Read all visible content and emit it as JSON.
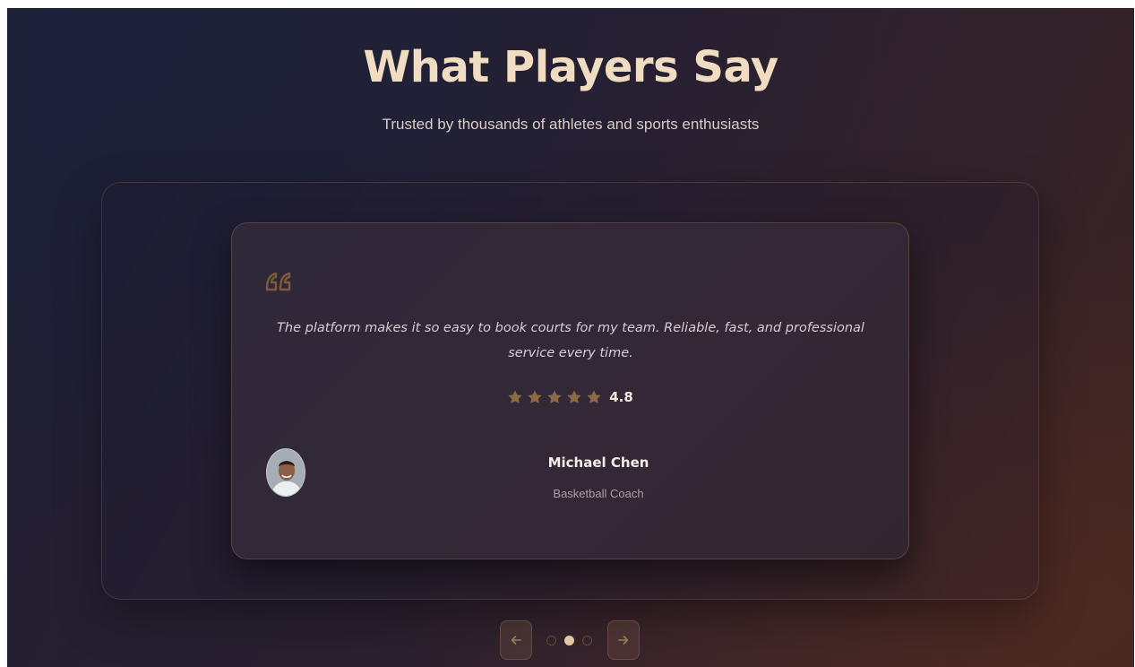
{
  "header": {
    "title": "What Players Say",
    "subtitle": "Trusted by thousands of athletes and sports enthusiasts"
  },
  "testimonial": {
    "quote": "The platform makes it so easy to book courts for my team. Reliable, fast, and professional service every time.",
    "rating": 4.8,
    "rating_label": "4.8",
    "stars": 5,
    "author": {
      "name": "Michael Chen",
      "role": "Basketball Coach"
    }
  },
  "carousel": {
    "slide_count": 3,
    "active_index": 1,
    "prev_icon": "arrow-left-icon",
    "next_icon": "arrow-right-icon"
  },
  "colors": {
    "accent": "#b08452",
    "title": "#f0dcc0",
    "active_dot": "#e1c9a3"
  }
}
